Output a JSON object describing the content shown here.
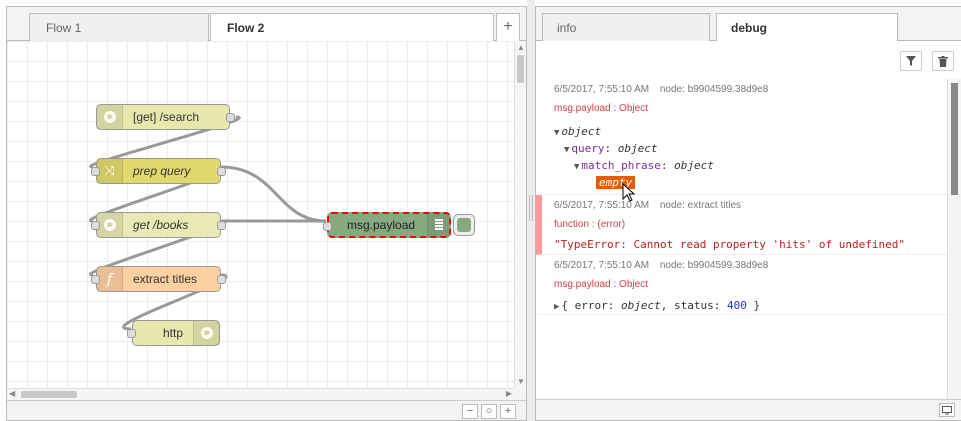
{
  "workspace": {
    "tabs": [
      {
        "label": "Flow 1",
        "active": false
      },
      {
        "label": "Flow 2",
        "active": true
      }
    ],
    "add_tab_label": "+",
    "zoom": {
      "out": "−",
      "reset": "○",
      "in": "+"
    }
  },
  "nodes": {
    "get_search": {
      "label": "[get] /search",
      "color": "#e7e7ae"
    },
    "prep_query": {
      "label": "prep query",
      "color": "#e2d96e"
    },
    "get_books": {
      "label": "get /books",
      "color": "#e9e9b4"
    },
    "extract_titles": {
      "label": "extract titles",
      "color": "#fdd0a2"
    },
    "http": {
      "label": "http",
      "color": "#e7e7ae"
    },
    "debug": {
      "label": "msg.payload",
      "color": "#87a980"
    }
  },
  "sidebar": {
    "tabs": [
      {
        "label": "info",
        "active": false
      },
      {
        "label": "debug",
        "active": true
      }
    ],
    "messages": [
      {
        "timestamp": "6/5/2017, 7:55:10 AM",
        "node": "node: b9904599.38d9e8",
        "topic": "msg.payload : Object",
        "tree": {
          "root_key": "object",
          "query_key": "query",
          "query_type": "object",
          "match_key": "match_phrase",
          "match_type": "object",
          "empty_label": "empty"
        }
      },
      {
        "timestamp": "6/5/2017, 7:55:10 AM",
        "node": "node: extract titles",
        "topic": "function : (error)",
        "error_text": "\"TypeError: Cannot read property 'hits' of undefined\""
      },
      {
        "timestamp": "6/5/2017, 7:55:10 AM",
        "node": "node: b9904599.38d9e8",
        "topic": "msg.payload : Object",
        "summary": {
          "open": "{",
          "k1": "error",
          "v1": "object",
          "k2": "status",
          "v2": "400",
          "close": "}"
        }
      }
    ]
  },
  "icons": {
    "filter": "filter-icon",
    "trash": "trash-icon",
    "monitor": "monitor-icon",
    "globe": "globe-icon",
    "shuffle": "shuffle-icon",
    "function": "function-icon",
    "list": "list-icon"
  },
  "colors": {
    "wire": "#999999",
    "error_bar": "#ff9999",
    "selected_border": "#ff0000",
    "empty_highlight": "#e65c00"
  }
}
